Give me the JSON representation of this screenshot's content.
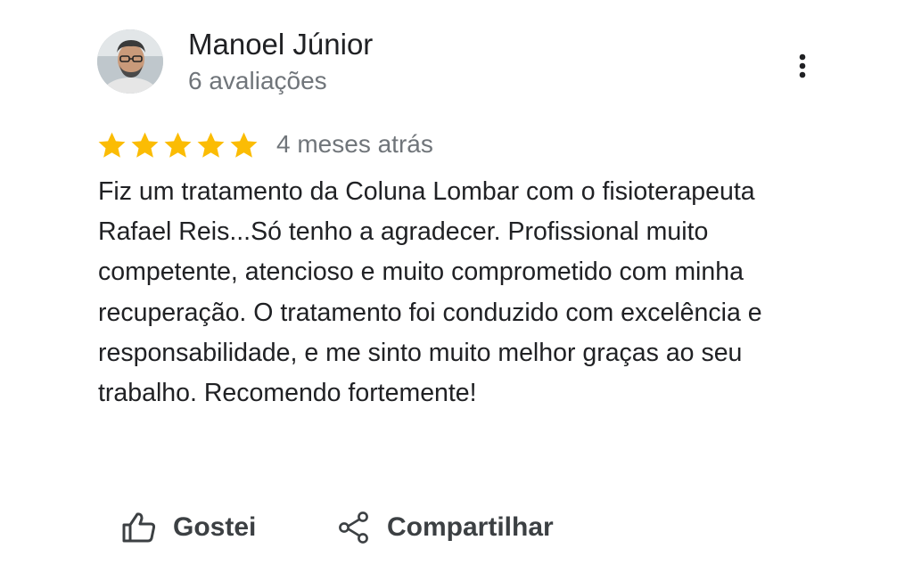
{
  "review": {
    "author": {
      "name": "Manoel Júnior",
      "meta": "6 avaliações"
    },
    "rating": {
      "stars": 5,
      "max": 5,
      "star_color": "#fbbc04"
    },
    "date": "4 meses atrás",
    "text": "Fiz um tratamento da Coluna Lombar com o fisioterapeuta Rafael Reis...Só tenho a agradecer. Profissional muito competente, atencioso e muito comprometido com minha recuperação. O tratamento foi conduzido com excelência e responsabilidade, e me sinto muito melhor graças ao seu trabalho. Recomendo fortemente!",
    "actions": {
      "like_label": "Gostei",
      "share_label": "Compartilhar"
    },
    "icons": {
      "more": "more-vert-icon",
      "like": "thumb-up-icon",
      "share": "share-icon"
    }
  }
}
